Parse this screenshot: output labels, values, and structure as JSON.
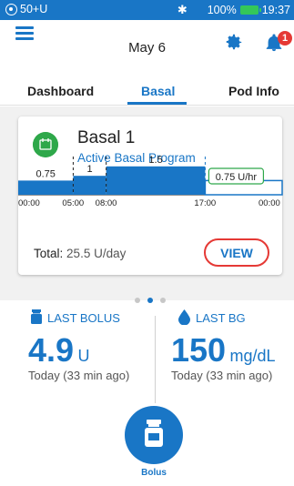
{
  "status_bar": {
    "left_text": "50+U",
    "battery": "100%",
    "time": "19:37"
  },
  "header": {
    "date": "May 6",
    "notification_count": "1"
  },
  "tabs": [
    {
      "label": "Dashboard",
      "active": false
    },
    {
      "label": "Basal",
      "active": true
    },
    {
      "label": "Pod Info",
      "active": false
    }
  ],
  "basal_card": {
    "program_name": "Basal 1",
    "program_status": "Active Basal Program",
    "current_rate_label": "0.75 U/hr",
    "total_label": "Total:",
    "total_value": "25.5 U/day",
    "view_label": "VIEW",
    "chart_data": {
      "type": "step",
      "time_labels": [
        "00:00",
        "05:00",
        "08:00",
        "17:00",
        "00:00"
      ],
      "segments": [
        {
          "start": "00:00",
          "end": "05:00",
          "rate": 0.75
        },
        {
          "start": "05:00",
          "end": "08:00",
          "rate": 1
        },
        {
          "start": "08:00",
          "end": "17:00",
          "rate": 1.5
        },
        {
          "start": "17:00",
          "end": "00:00",
          "rate": 0.75
        }
      ],
      "rate_labels": [
        "0.75",
        "1",
        "1.5",
        "0.75"
      ]
    }
  },
  "pager": {
    "count": 3,
    "active_index": 1
  },
  "last_bolus": {
    "label": "LAST BOLUS",
    "value": "4.9",
    "unit": "U",
    "time": "Today (33 min ago)"
  },
  "last_bg": {
    "label": "LAST BG",
    "value": "150",
    "unit": "mg/dL",
    "time": "Today (33 min ago)"
  },
  "bolus_button": {
    "label": "Bolus"
  },
  "colors": {
    "primary": "#1976c6",
    "alert": "#e53935",
    "program": "#2ea84a"
  }
}
